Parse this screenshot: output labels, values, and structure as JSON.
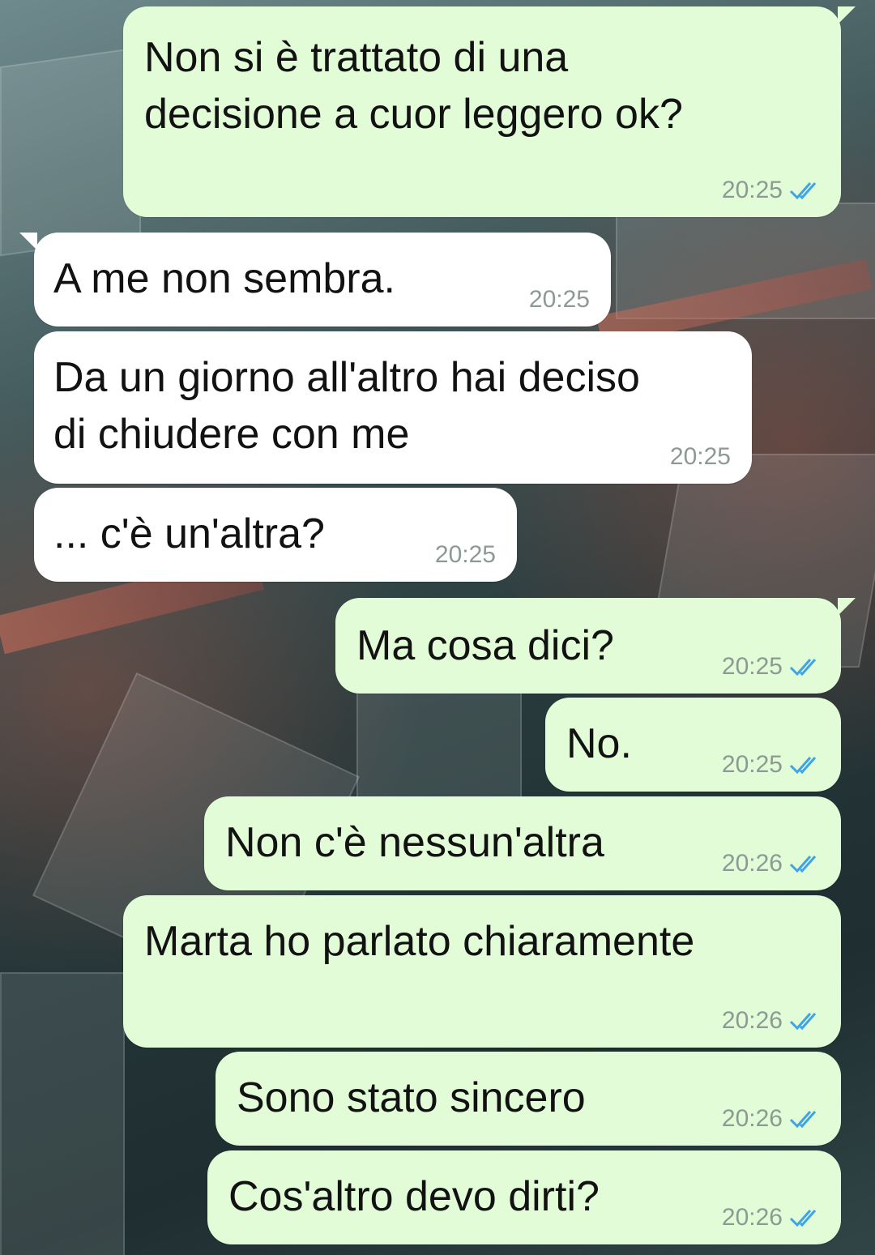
{
  "colors": {
    "outgoing_bubble": "#e1fcd6",
    "incoming_bubble": "#ffffff",
    "read_tick": "#3fa3e8",
    "timestamp": "#8d9a93"
  },
  "messages": [
    {
      "text": "Non si è trattato di una\ndecisione a cuor leggero ok?",
      "time": "20:25",
      "direction": "outgoing",
      "status_icon": "double-check-read-icon"
    },
    {
      "text": "A me non sembra.",
      "time": "20:25",
      "direction": "incoming"
    },
    {
      "text": "Da un giorno all'altro hai deciso\ndi chiudere con me",
      "time": "20:25",
      "direction": "incoming"
    },
    {
      "text": "... c'è un'altra?",
      "time": "20:25",
      "direction": "incoming"
    },
    {
      "text": "Ma cosa dici?",
      "time": "20:25",
      "direction": "outgoing",
      "status_icon": "double-check-read-icon"
    },
    {
      "text": "No.",
      "time": "20:25",
      "direction": "outgoing",
      "status_icon": "double-check-read-icon"
    },
    {
      "text": "Non c'è nessun'altra",
      "time": "20:26",
      "direction": "outgoing",
      "status_icon": "double-check-read-icon"
    },
    {
      "text": "Marta ho parlato chiaramente",
      "time": "20:26",
      "direction": "outgoing",
      "status_icon": "double-check-read-icon"
    },
    {
      "text": "Sono stato sincero",
      "time": "20:26",
      "direction": "outgoing",
      "status_icon": "double-check-read-icon"
    },
    {
      "text": "Cos'altro devo dirti?",
      "time": "20:26",
      "direction": "outgoing",
      "status_icon": "double-check-read-icon"
    }
  ]
}
